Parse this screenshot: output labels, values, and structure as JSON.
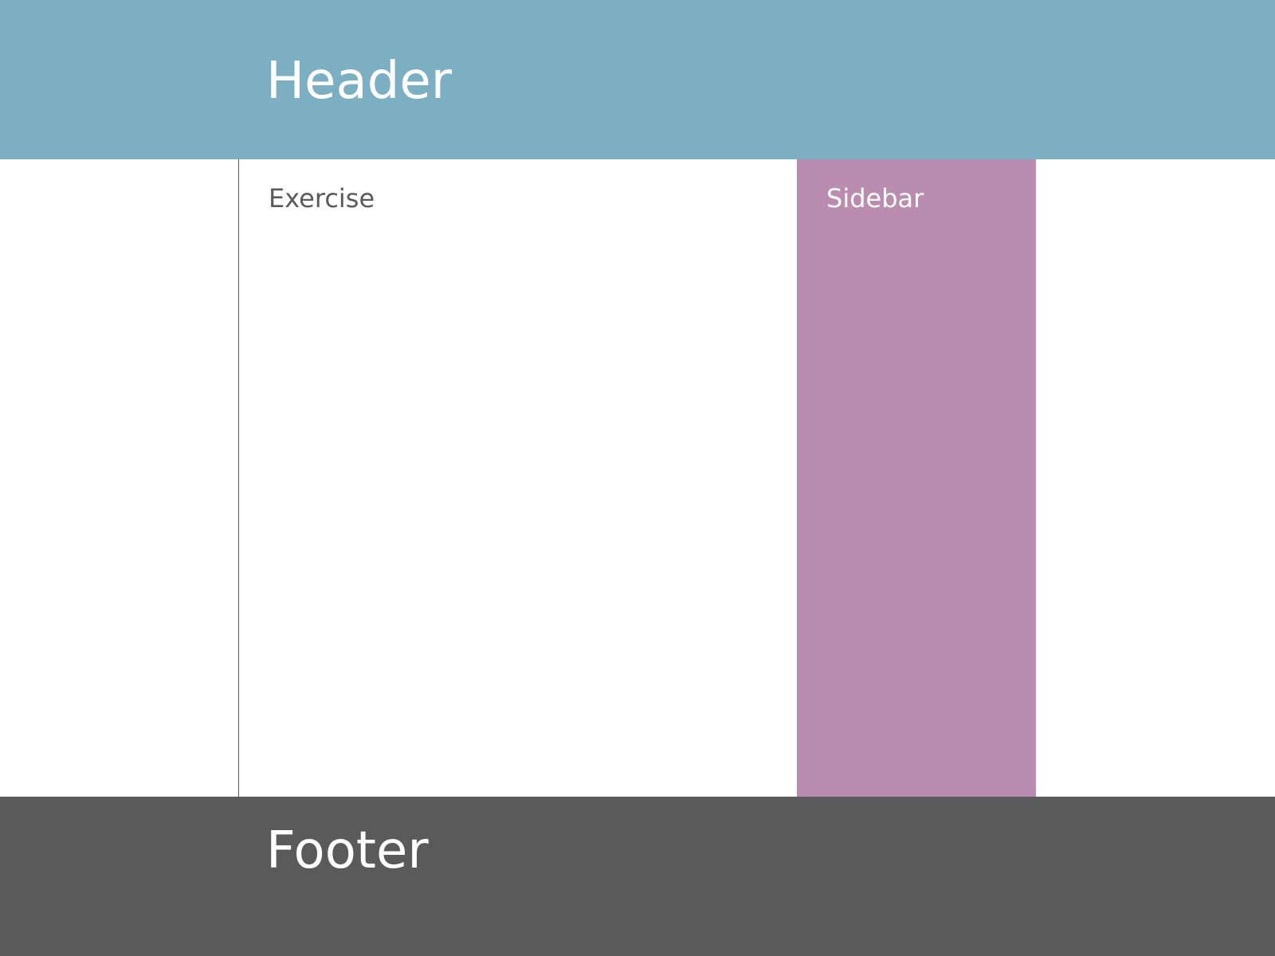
{
  "header": {
    "title": "Header",
    "background": "#7dafc3"
  },
  "main": {
    "title": "Exercise",
    "text_color": "#5a5a5a"
  },
  "sidebar": {
    "title": "Sidebar",
    "background": "#ba8caf"
  },
  "footer": {
    "title": "Footer",
    "background": "#5a5a5a"
  }
}
